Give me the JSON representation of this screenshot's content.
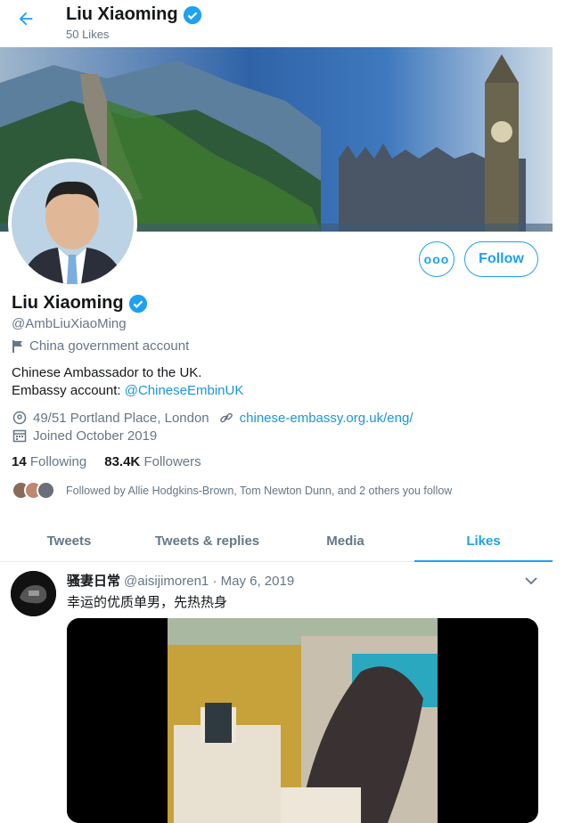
{
  "header": {
    "title": "Liu Xiaoming",
    "subtitle": "50 Likes"
  },
  "profile": {
    "name": "Liu Xiaoming",
    "handle": "@AmbLiuXiaoMing",
    "label": "China government account",
    "bio_line1": "Chinese Ambassador to the UK.",
    "bio_line2_prefix": "Embassy account: ",
    "bio_link": "@ChineseEmbinUK",
    "location": "49/51 Portland Place, London",
    "website": "chinese-embassy.org.uk/eng/",
    "joined": "Joined October 2019",
    "following_count": "14",
    "following_label": "Following",
    "followers_count": "83.4K",
    "followers_label": "Followers",
    "followed_by": "Followed by Allie Hodgkins-Brown, Tom Newton Dunn, and 2 others you follow"
  },
  "actions": {
    "more_label": "ooo",
    "follow_label": "Follow"
  },
  "tabs": [
    {
      "label": "Tweets",
      "active": false
    },
    {
      "label": "Tweets & replies",
      "active": false
    },
    {
      "label": "Media",
      "active": false
    },
    {
      "label": "Likes",
      "active": true
    }
  ],
  "tweet": {
    "author_name": "骚妻日常",
    "author_handle": "@aisijimoren1",
    "separator": "·",
    "date": "May 6, 2019",
    "text": "幸运的优质单男，先热热身"
  },
  "colors": {
    "accent": "#1da1f2",
    "link": "#1b95e0",
    "muted": "#657786"
  },
  "icons": [
    "back-arrow-icon",
    "verified-icon",
    "flag-icon",
    "location-icon",
    "link-icon",
    "calendar-icon",
    "chevron-down-icon"
  ]
}
